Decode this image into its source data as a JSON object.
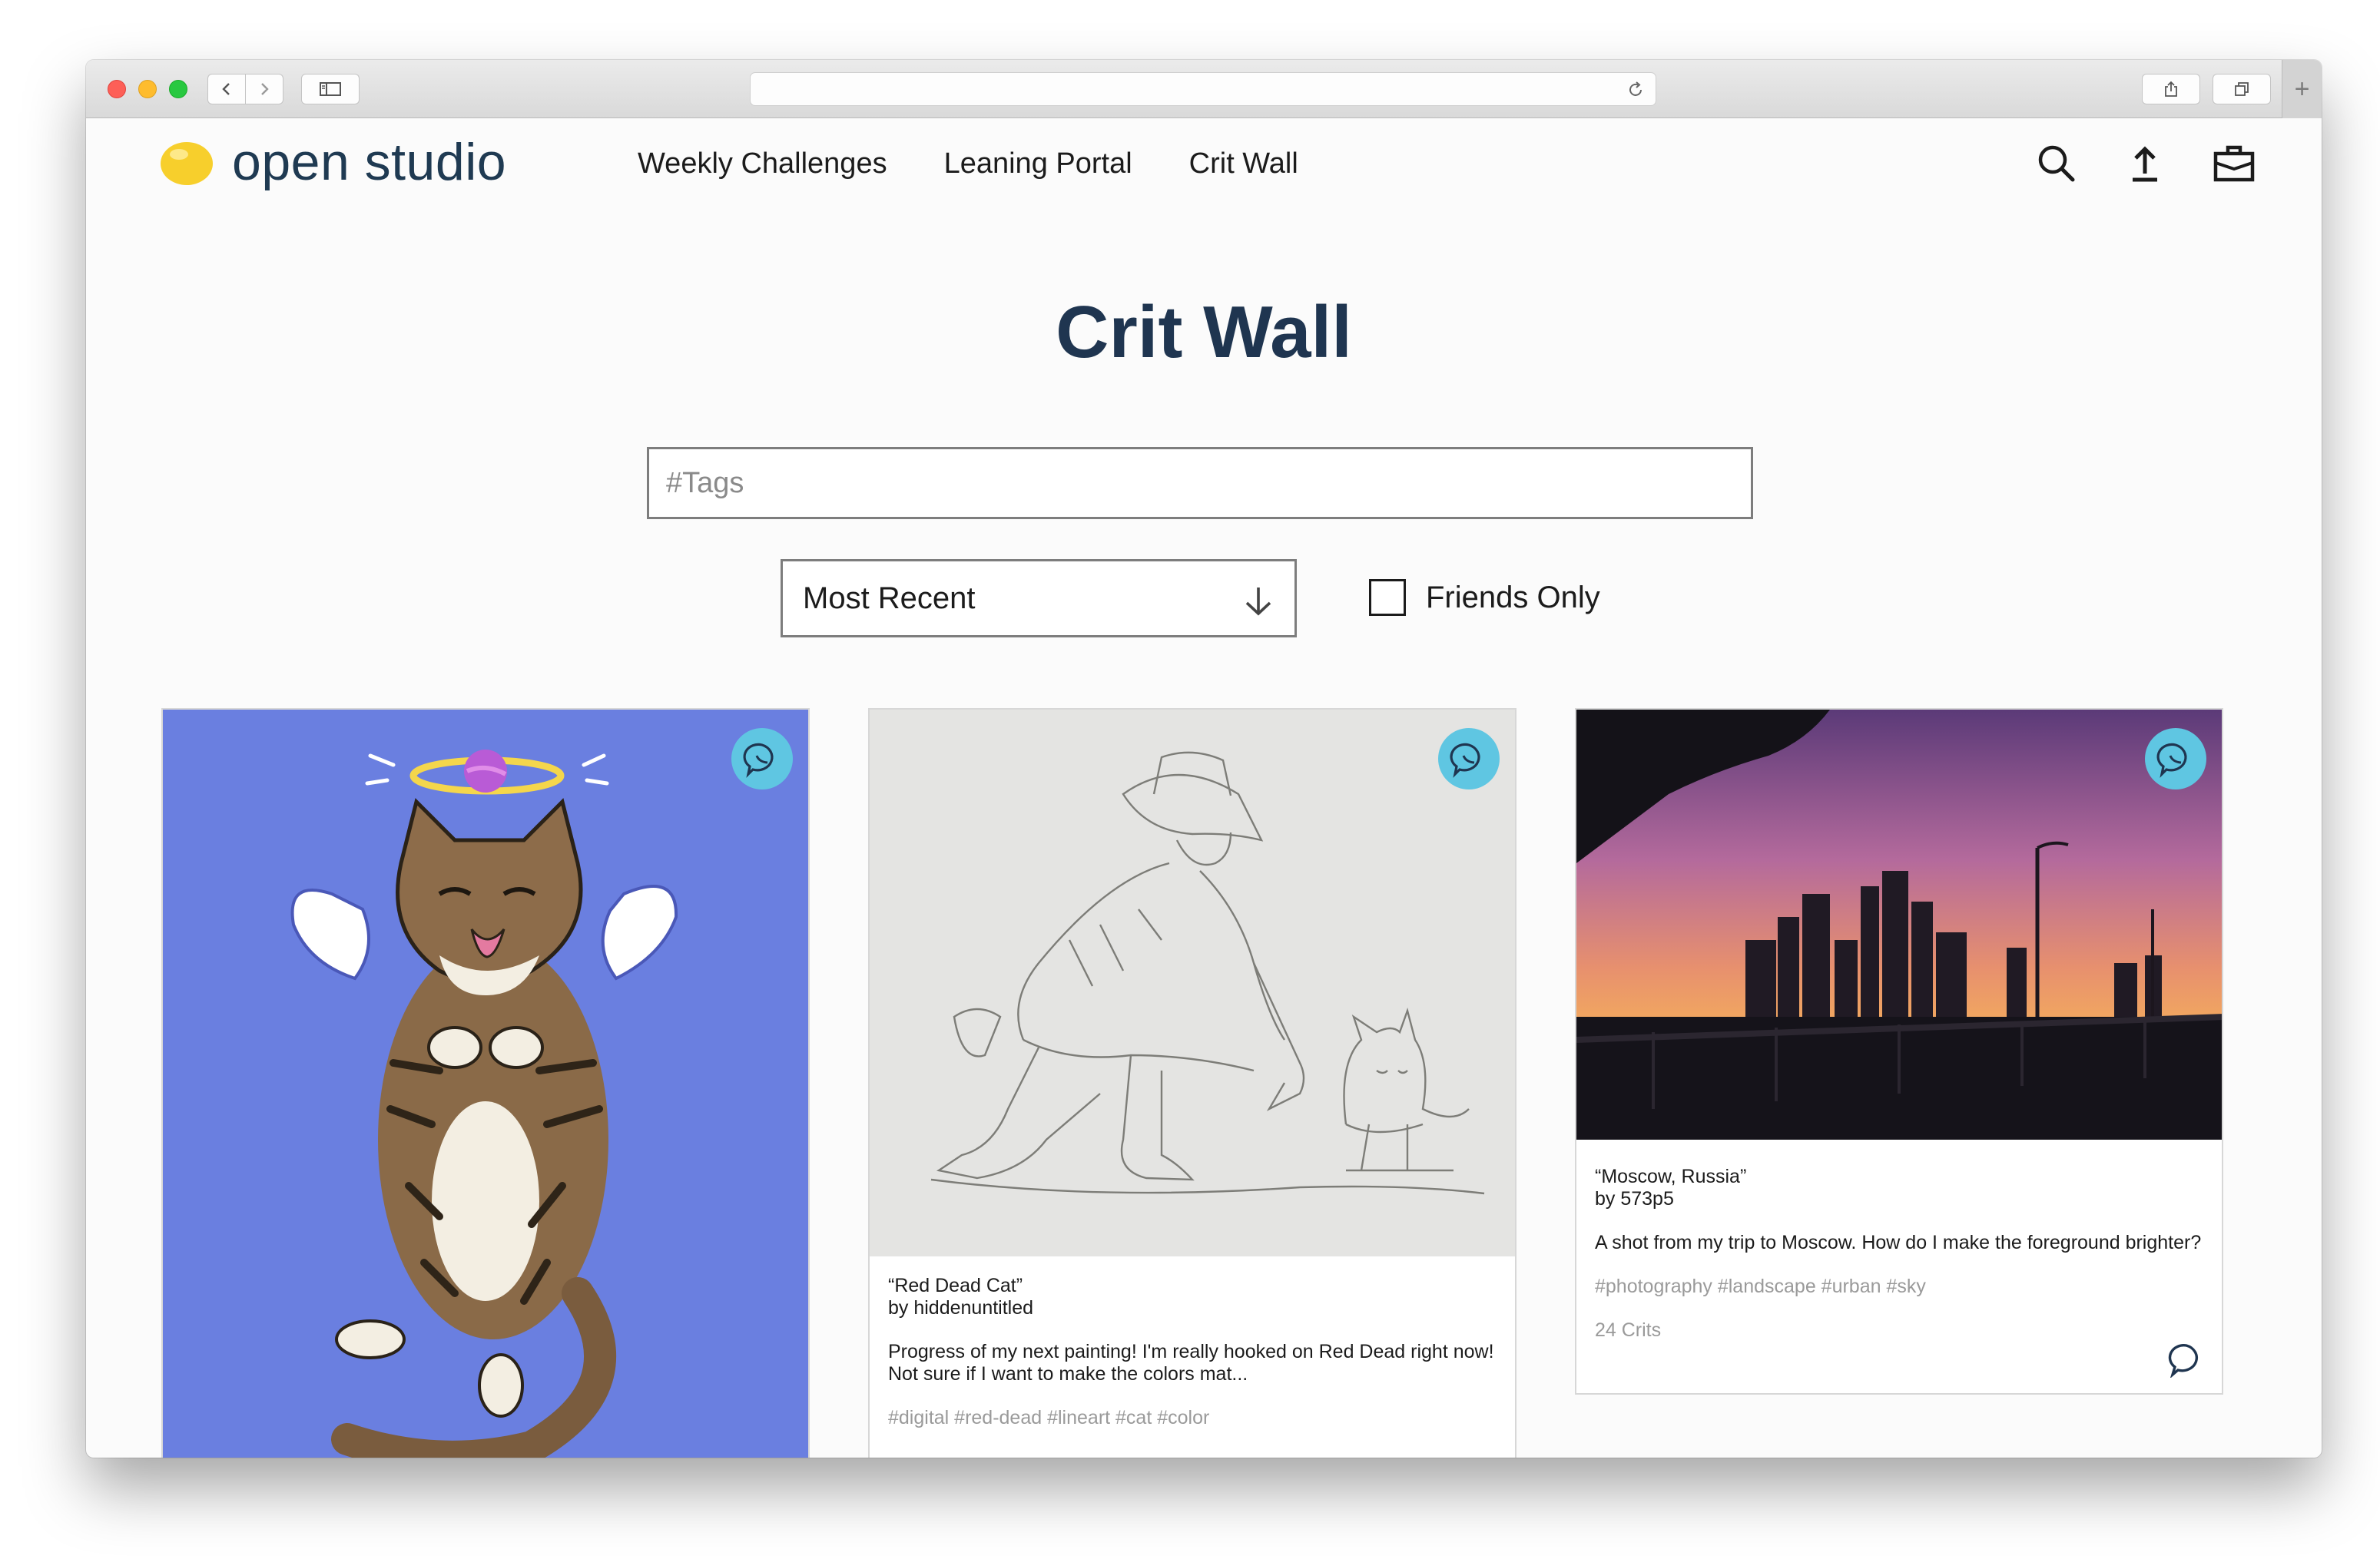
{
  "browser": {
    "new_tab_label": "+"
  },
  "site": {
    "logo_text": "open studio",
    "nav": [
      "Weekly Challenges",
      "Leaning Portal",
      "Crit Wall"
    ],
    "accent": "#f7cf2c",
    "brand_color": "#1f3a52"
  },
  "main": {
    "title": "Crit Wall",
    "tags_placeholder": "#Tags",
    "sort": {
      "selected": "Most Recent"
    },
    "friends_only": {
      "label": "Friends Only",
      "checked": false
    }
  },
  "posts": [
    {
      "image": "cat-angel-illustration",
      "background": "#6a7fe0"
    },
    {
      "image": "cowboy-cat-sketch",
      "title": "“Red Dead Cat”",
      "author": "by hiddenuntitled",
      "description": "Progress of my next painting! I'm really hooked on Red Dead right now! Not sure if I want to make the colors mat...",
      "tags": "#digital #red-dead #lineart #cat #color"
    },
    {
      "image": "moscow-skyline-sunset",
      "title": "“Moscow, Russia”",
      "author": "by 573p5",
      "description": "A shot from my trip to Moscow. How do I make the foreground brighter?",
      "tags": "#photography #landscape #urban #sky",
      "crits": "24 Crits"
    }
  ]
}
